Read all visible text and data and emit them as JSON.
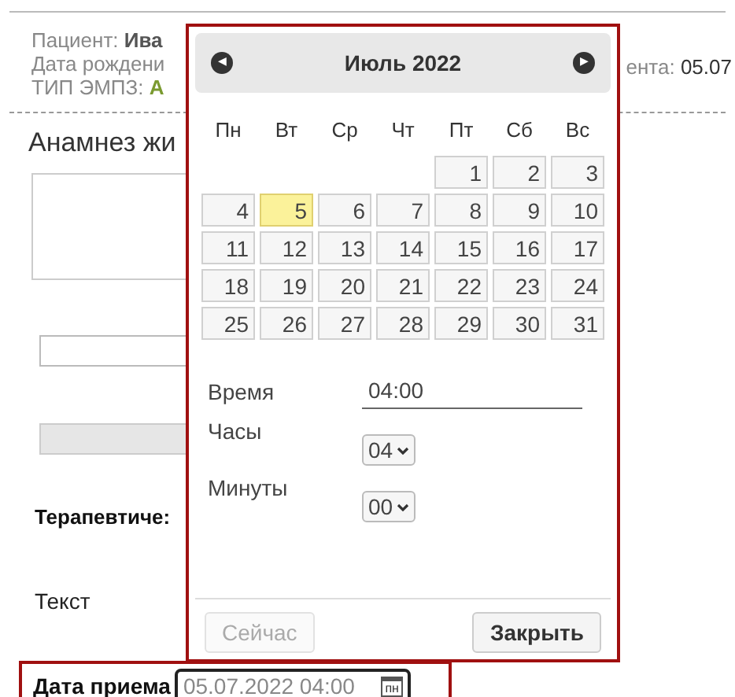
{
  "patient_header": {
    "patient_label": "Пациент:",
    "patient_value": "Ива",
    "birth_label": "Дата рождени",
    "right_label": "ента:",
    "right_value": "05.07",
    "type_label": "ТИП ЭМПЗ:",
    "type_value": "А"
  },
  "section_title": "Анамнез жи",
  "therapy_label": "Терапевтиче:",
  "text_label": "Текст",
  "visit_date": {
    "label": "Дата приема",
    "value": "05.07.2022 04:00",
    "icon_text": "пн"
  },
  "datepicker": {
    "prev": "◀",
    "next": "▶",
    "title": "Июль 2022",
    "weekdays": [
      "Пн",
      "Вт",
      "Ср",
      "Чт",
      "Пт",
      "Сб",
      "Вс"
    ],
    "weeks": [
      [
        {
          "day": "1",
          "selected": false
        },
        {
          "day": "2",
          "selected": false
        },
        {
          "day": "3",
          "selected": false
        }
      ],
      [
        {
          "day": "4",
          "selected": false
        },
        {
          "day": "5",
          "selected": true
        },
        {
          "day": "6",
          "selected": false
        },
        {
          "day": "7",
          "selected": false
        },
        {
          "day": "8",
          "selected": false
        },
        {
          "day": "9",
          "selected": false
        },
        {
          "day": "10",
          "selected": false
        }
      ],
      [
        {
          "day": "11",
          "selected": false
        },
        {
          "day": "12",
          "selected": false
        },
        {
          "day": "13",
          "selected": false
        },
        {
          "day": "14",
          "selected": false
        },
        {
          "day": "15",
          "selected": false
        },
        {
          "day": "16",
          "selected": false
        },
        {
          "day": "17",
          "selected": false
        }
      ],
      [
        {
          "day": "18",
          "selected": false
        },
        {
          "day": "19",
          "selected": false
        },
        {
          "day": "20",
          "selected": false
        },
        {
          "day": "21",
          "selected": false
        },
        {
          "day": "22",
          "selected": false
        },
        {
          "day": "23",
          "selected": false
        },
        {
          "day": "24",
          "selected": false
        }
      ],
      [
        {
          "day": "25",
          "selected": false
        },
        {
          "day": "26",
          "selected": false
        },
        {
          "day": "27",
          "selected": false
        },
        {
          "day": "28",
          "selected": false
        },
        {
          "day": "29",
          "selected": false
        },
        {
          "day": "30",
          "selected": false
        },
        {
          "day": "31",
          "selected": false
        }
      ]
    ],
    "time_label": "Время",
    "time_value": "04:00",
    "hours_label": "Часы",
    "hours_value": "04",
    "minutes_label": "Минуты",
    "minutes_value": "00",
    "now_button": {
      "label": "Сейчас",
      "disabled": true
    },
    "close_button": {
      "label": "Закрыть",
      "disabled": false
    }
  }
}
